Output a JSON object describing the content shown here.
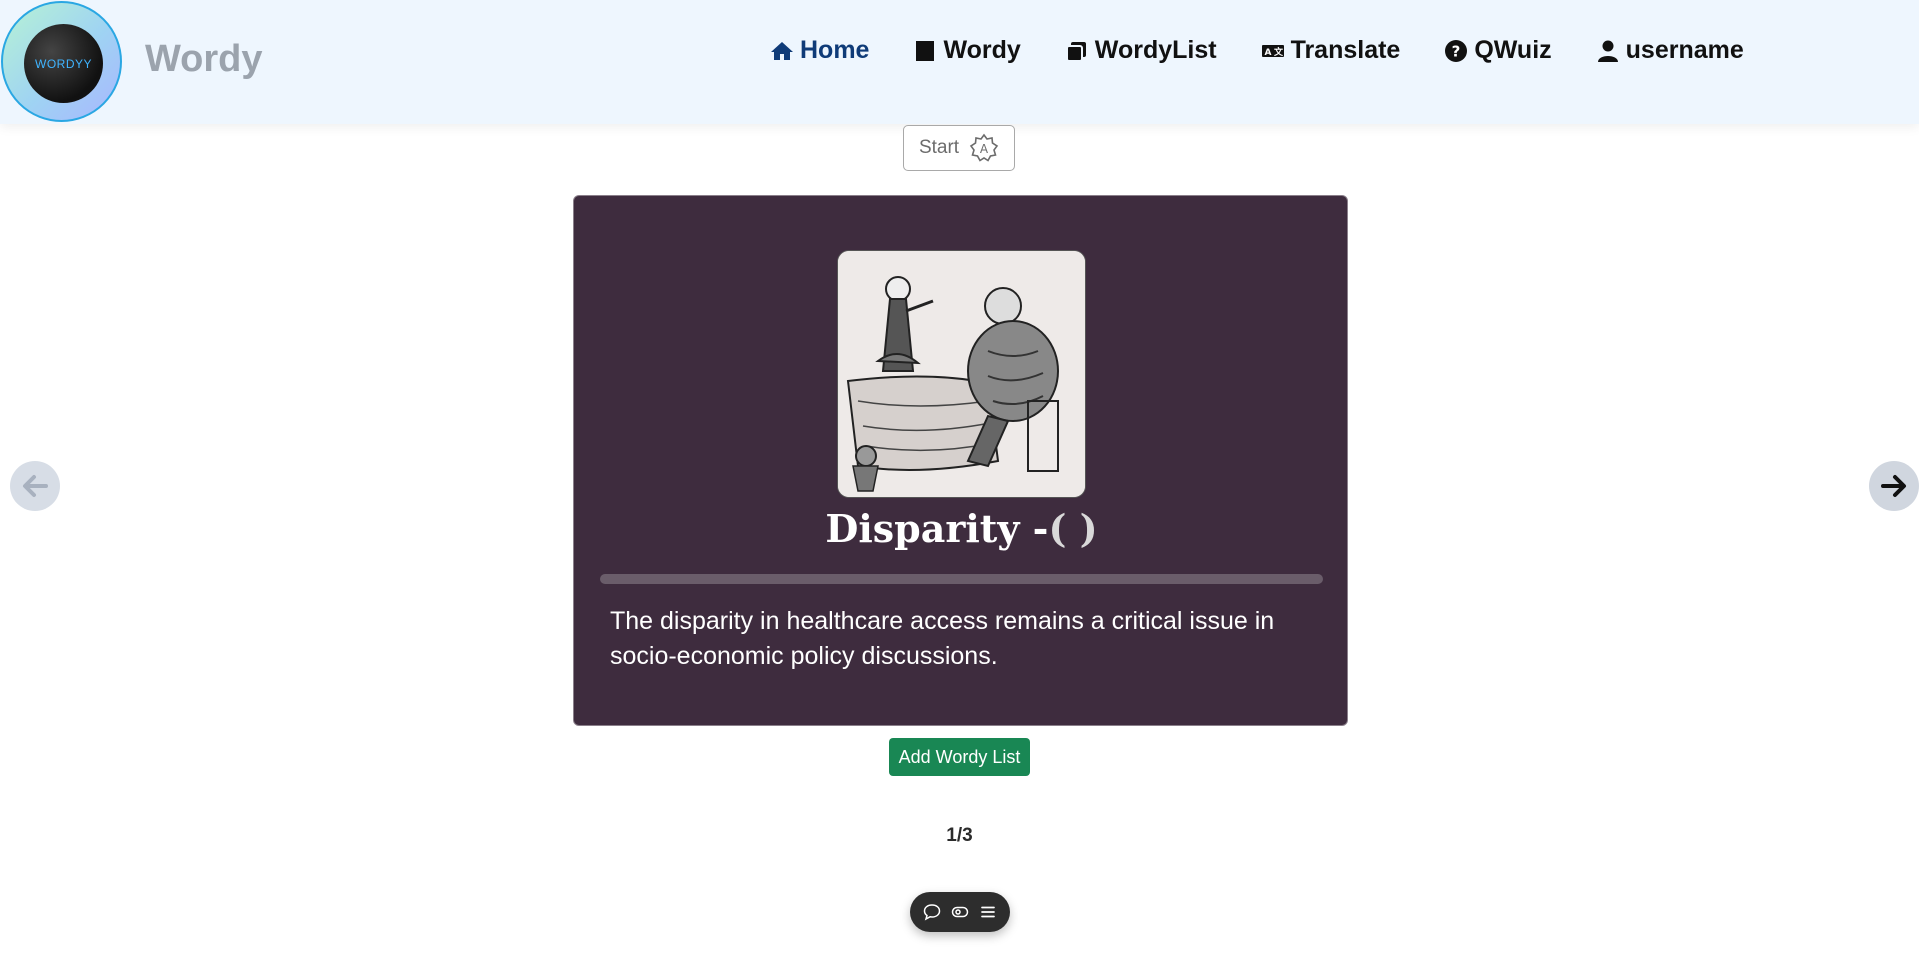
{
  "header": {
    "logo_text": "WORDYY",
    "brand": "Wordy",
    "nav": [
      {
        "label": "Home",
        "icon": "home-icon",
        "active": true
      },
      {
        "label": "Wordy",
        "icon": "square-icon"
      },
      {
        "label": "WordyList",
        "icon": "list-stack-icon"
      },
      {
        "label": "Translate",
        "icon": "translate-icon"
      },
      {
        "label": "QWuiz",
        "icon": "question-circle-icon"
      },
      {
        "label": "username",
        "icon": "user-icon"
      }
    ]
  },
  "start_button": {
    "label": "Start",
    "icon": "auto-badge-icon"
  },
  "card": {
    "word": "Disparity -",
    "paren": "( )",
    "sentence": "The disparity in healthcare access remains a critical issue in socio-economic policy discussions."
  },
  "add_button": {
    "label": "Add Wordy List"
  },
  "pagination": {
    "text": "1/3",
    "current": 1,
    "total": 3
  },
  "colors": {
    "header_bg": "#eef6fe",
    "card_bg": "#3e2c3e",
    "active_nav": "#0f3b78",
    "add_button": "#198754"
  }
}
